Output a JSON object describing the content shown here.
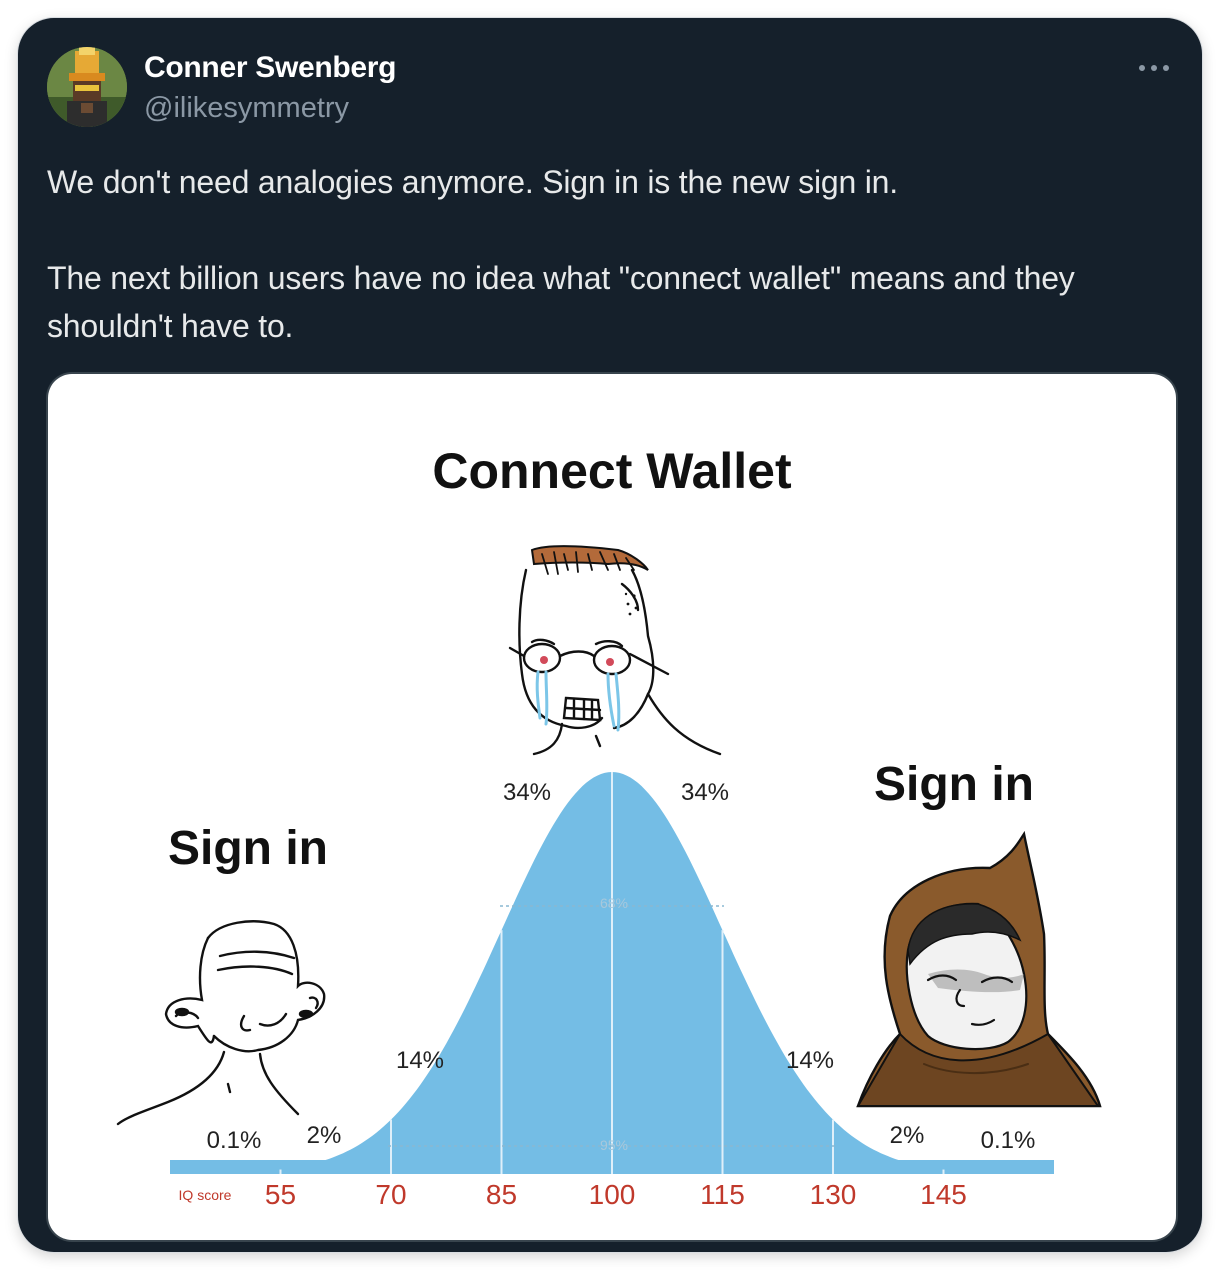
{
  "tweet": {
    "author_name": "Conner Swenberg",
    "author_handle": "@ilikesymmetry",
    "more_icon": "more-horizontal-icon",
    "text_line1": "We don't need analogies anymore. Sign in is the new sign in.",
    "text_line2": "The next billion users have no idea what \"connect wallet\" means and they shouldn't have to."
  },
  "meme": {
    "title": "Connect Wallet",
    "left_label": "Sign in",
    "right_label": "Sign in",
    "percent_labels": {
      "far_left": "0.1%",
      "left_2": "2%",
      "left_14": "14%",
      "center_left": "34%",
      "center_right": "34%",
      "right_14": "14%",
      "right_2": "2%",
      "far_right": "0.1%",
      "band_68": "68%",
      "band_95": "95%"
    },
    "axis_title": "IQ score",
    "colors": {
      "curve_fill": "#74bde5",
      "tick_label": "#c0392b",
      "text": "#111111"
    }
  },
  "chart_data": {
    "type": "area",
    "title": "Connect Wallet",
    "xlabel": "IQ score",
    "ylabel": "",
    "x_ticks": [
      55,
      70,
      85,
      100,
      115,
      130,
      145
    ],
    "xlim": [
      55,
      145
    ],
    "mean": 100,
    "std": 15,
    "segments": [
      {
        "range": "<55",
        "percent": "0.1%"
      },
      {
        "range": "55-70",
        "percent": "2%"
      },
      {
        "range": "70-85",
        "percent": "14%"
      },
      {
        "range": "85-100",
        "percent": "34%"
      },
      {
        "range": "100-115",
        "percent": "34%"
      },
      {
        "range": "115-130",
        "percent": "14%"
      },
      {
        "range": "130-145",
        "percent": "2%"
      },
      {
        "range": ">145",
        "percent": "0.1%"
      }
    ],
    "bands": [
      {
        "label": "68%",
        "range": [
          85,
          115
        ]
      },
      {
        "label": "95%",
        "range": [
          70,
          130
        ]
      }
    ]
  }
}
